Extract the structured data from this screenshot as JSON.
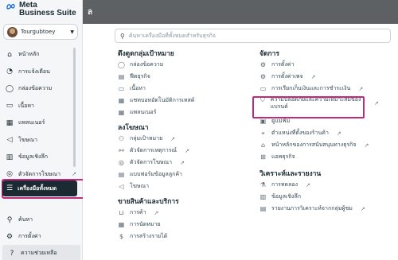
{
  "backdrop_title": "ล",
  "brand": {
    "line1": "Meta",
    "line2": "Business Suite"
  },
  "account": {
    "name": "Tourgubtoey"
  },
  "nav": [
    {
      "label": "หน้าหลัก",
      "icon": "home-icon"
    },
    {
      "label": "การแจ้งเตือน",
      "icon": "bell-icon"
    },
    {
      "label": "กล่องข้อความ",
      "icon": "chat-icon"
    },
    {
      "label": "เนื้อหา",
      "icon": "content-icon"
    },
    {
      "label": "แพลนเนอร์",
      "icon": "calendar-icon"
    },
    {
      "label": "โฆษณา",
      "icon": "megaphone-icon"
    },
    {
      "label": "ข้อมูลเชิงลึก",
      "icon": "chart-icon"
    },
    {
      "label": "ตัวจัดการโฆษณา",
      "icon": "target-icon",
      "external": true
    }
  ],
  "all_tools": {
    "label": "เครื่องมือทั้งหมด"
  },
  "nav_bottom": [
    {
      "label": "ค้นหา",
      "icon": "search-icon"
    },
    {
      "label": "การตั้งค่า",
      "icon": "gear-icon"
    },
    {
      "label": "ความช่วยเหลือ",
      "icon": "help-icon"
    }
  ],
  "search": {
    "placeholder": "ค้นหาเครื่องมือที่ทั้งหมดสำหรับธุรกิจ"
  },
  "col1": {
    "sections": [
      {
        "title": "ดึงดูดกลุ่มเป้าหมาย",
        "items": [
          {
            "label": "กล่องข้อความ",
            "icon": "chat-icon"
          },
          {
            "label": "ฟีดธุรกิจ",
            "icon": "feed-icon"
          },
          {
            "label": "เนื้อหา",
            "icon": "content-icon"
          },
          {
            "label": "แชทบอทอัตโนมัติการเทสต์",
            "icon": "calendar-icon"
          },
          {
            "label": "แพลนเนอร์",
            "icon": "calendar-icon"
          }
        ]
      },
      {
        "title": "ลงโฆษณา",
        "items": [
          {
            "label": "กลุ่มเป้าหมาย",
            "icon": "people-icon",
            "external": true
          },
          {
            "label": "ตัวจัดการเหตุการณ์",
            "icon": "link-icon",
            "external": true
          },
          {
            "label": "ตัวจัดการโฆษณา",
            "icon": "target-icon",
            "external": true
          },
          {
            "label": "แบบฟอร์มข้อมูลลูกค้า",
            "icon": "form-icon"
          },
          {
            "label": "โฆษณา",
            "icon": "megaphone-icon"
          }
        ]
      },
      {
        "title": "ขายสินค้าและบริการ",
        "items": [
          {
            "label": "การค้า",
            "icon": "cart-icon",
            "external": true
          },
          {
            "label": "การนัดหมาย",
            "icon": "calendar-icon"
          },
          {
            "label": "การสร้างรายได้",
            "icon": "money-icon"
          }
        ]
      }
    ]
  },
  "col2": {
    "sections": [
      {
        "title": "จัดการ",
        "items": [
          {
            "label": "การตั้งค่า",
            "icon": "gear-icon"
          },
          {
            "label": "การตั้งค่าเพจ",
            "icon": "gear-icon",
            "external": true
          },
          {
            "label": "การเรียกเก็บเงินและการชำระเงิน",
            "icon": "card-icon",
            "external": true
          },
          {
            "label": "ความปลอดภัยและความเหมาะสมของแบรนด์",
            "icon": "shield-icon",
            "external": true,
            "highlighted": true
          },
          {
            "label": "ดูแม่ฟ้ม",
            "icon": "media-icon"
          },
          {
            "label": "ตำแหน่งที่ตั้งของร้านค้า",
            "icon": "store-icon",
            "external": true
          },
          {
            "label": "หน้าหลักของการสนับสนุนทางธุรกิจ",
            "icon": "support-icon",
            "external": true
          },
          {
            "label": "แอพธุรกิจ",
            "icon": "grid-icon"
          }
        ]
      },
      {
        "title": "วิเคราะห์และรายงาน",
        "items": [
          {
            "label": "การทดลอง",
            "icon": "flask-icon",
            "external": true
          },
          {
            "label": "ข้อมูลเชิงลึก",
            "icon": "chart-icon"
          },
          {
            "label": "รายงานการวิเคราะห์จากกลุ่มผู้ชม",
            "icon": "report-icon",
            "external": true
          }
        ]
      }
    ]
  },
  "colors": {
    "highlight": "#c2297a",
    "dark_pill": "#1c2b33",
    "meta_blue": "#0668e1"
  }
}
